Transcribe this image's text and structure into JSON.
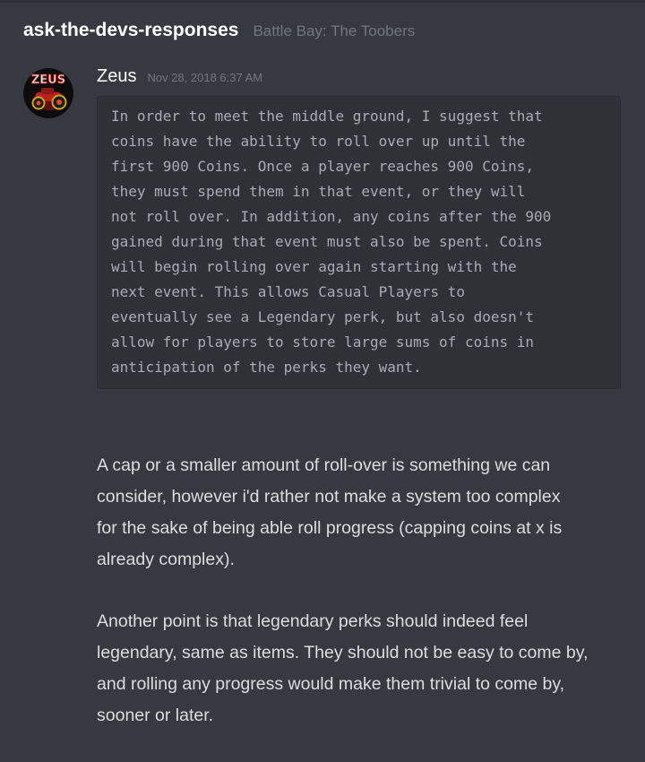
{
  "channel": {
    "name": "ask-the-devs-responses",
    "server": "Battle Bay: The Toobers"
  },
  "message": {
    "author": "Zeus",
    "timestamp": "Nov 28, 2018 6:37 AM",
    "avatar_icon": "zeus-avatar",
    "quote_lines": [
      "In order to meet the middle ground, I suggest that",
      "coins have the ability to roll over up until the",
      "first 900 Coins. Once a player reaches 900 Coins,",
      "they must spend them in that event, or they will",
      "not roll over. In addition, any coins after the 900",
      "gained during that event must also be spent. Coins",
      "will begin rolling over again starting with the",
      "next event. This allows Casual Players to",
      "eventually see a Legendary perk, but also doesn't",
      "allow for players to store large sums of coins in",
      "anticipation of the perks they want."
    ],
    "reply_paragraphs": [
      {
        "lines": [
          "A cap or a smaller amount of roll-over is something we can",
          "consider, however i'd rather not make a system too complex",
          "for the sake of being able roll progress (capping coins at x is",
          "already complex)."
        ]
      },
      {
        "lines": [
          "Another point is that legendary perks should indeed feel",
          "legendary, same as items. They should not be easy to come by,",
          "and rolling any progress would make them trivial to come by,",
          "sooner or later."
        ]
      }
    ]
  },
  "colors": {
    "background": "#36393f",
    "codeblock_bg": "#2f3136",
    "text": "#dcddde",
    "muted": "#72767d"
  }
}
